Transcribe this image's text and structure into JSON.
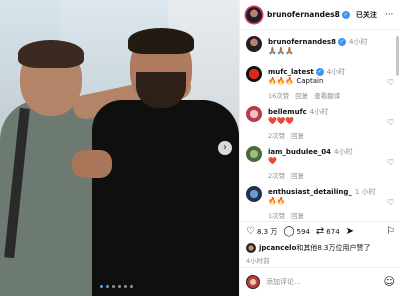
{
  "post": {
    "username": "brunofernandes8",
    "follow_label": "已关注",
    "more_icon": "more-horizontal-icon"
  },
  "caption": {
    "username": "brunofernandes8",
    "time": "4小时",
    "text": "🙏🏽🙏🏽🙏🏽"
  },
  "comments": [
    {
      "username": "mufc_latest",
      "verified": true,
      "time": "4小时",
      "text": "🔥🔥🔥 Captain",
      "likes": "16次赞",
      "reply": "回复",
      "extra": "查看翻译"
    },
    {
      "username": "bellemufc",
      "verified": false,
      "time": "4小时",
      "text": "❤️❤️❤️",
      "likes": "2次赞",
      "reply": "回复",
      "extra": ""
    },
    {
      "username": "iam_budulee_04",
      "verified": false,
      "time": "4小时",
      "text": "❤️",
      "likes": "2次赞",
      "reply": "回复",
      "extra": ""
    },
    {
      "username": "enthusiast_detailing_",
      "verified": false,
      "time": "1 小时",
      "text": "🔥🔥",
      "likes": "1次赞",
      "reply": "回复",
      "extra": ""
    }
  ],
  "actions": {
    "likes_count": "8.3 万",
    "comments_count": "594",
    "reposts_count": "674"
  },
  "liked_by": {
    "username": "jpcancelo",
    "text": "和其他8.3万位用户赞了"
  },
  "posted_time": "4小时前",
  "composer": {
    "placeholder": "添加评论..."
  },
  "carousel": {
    "current": 1,
    "total": 6
  },
  "colors": {
    "verified": "#3897f0",
    "story_ring": "#e1306c",
    "heart": "#e0102d",
    "active_dot": "#4aa3ff"
  }
}
